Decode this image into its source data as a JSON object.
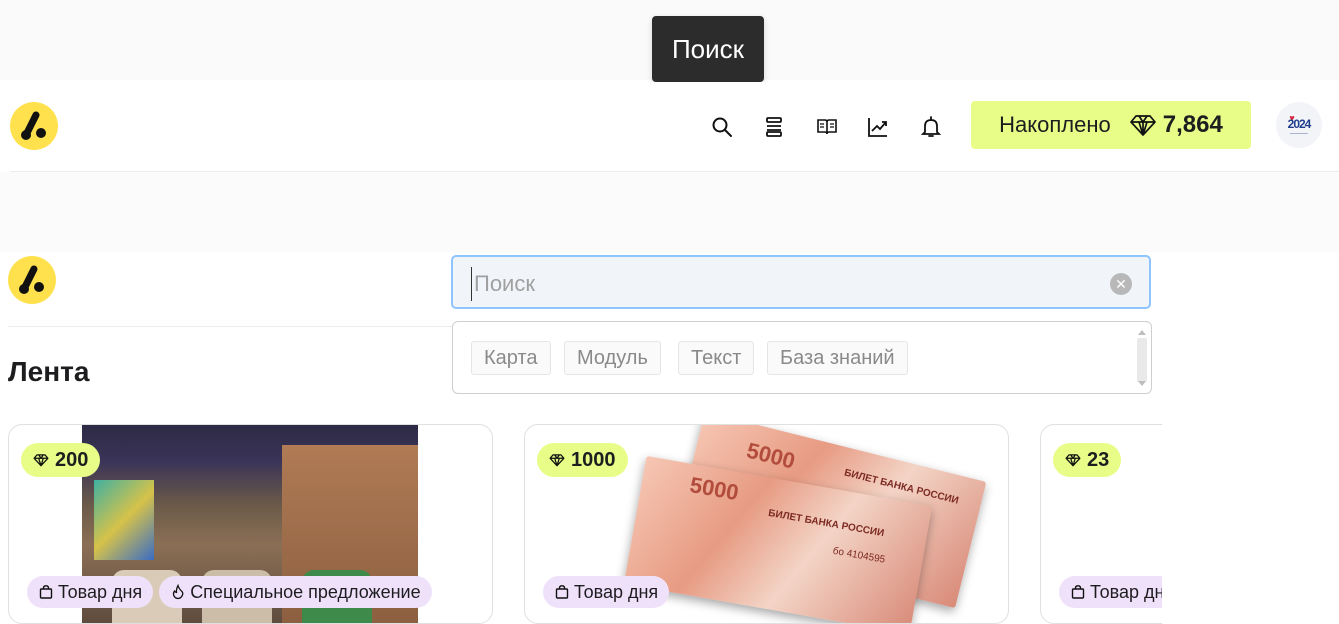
{
  "tooltip": {
    "text": "Поиск"
  },
  "header": {
    "icons": [
      "search-icon",
      "layers-icon",
      "book-icon",
      "trending-icon",
      "bell-icon"
    ],
    "accumulated": {
      "label": "Накоплено",
      "amount": "7,864",
      "icon": "diamond-icon"
    },
    "avatar": {
      "year": "2024"
    }
  },
  "search": {
    "placeholder": "Поиск",
    "value": "",
    "suggestions": [
      "Карта",
      "Модуль",
      "Текст",
      "База знаний"
    ]
  },
  "feed": {
    "title": "Лента",
    "cards": [
      {
        "price": "200",
        "tags": [
          "Товар дня",
          "Специальное предложение"
        ]
      },
      {
        "price": "1000",
        "tags": [
          "Товар дня"
        ]
      },
      {
        "price": "23",
        "tags": [
          "Товар дн"
        ]
      }
    ]
  },
  "banknote": {
    "denomination": "5000",
    "text": "БИЛЕТ БАНКА РОССИИ",
    "serial": "бо 4104595"
  },
  "colors": {
    "accent_yellow": "#e7fd88",
    "logo_yellow": "#ffe14d",
    "tag_purple": "#f0e1fb",
    "focus_blue": "#8ec5ff"
  }
}
